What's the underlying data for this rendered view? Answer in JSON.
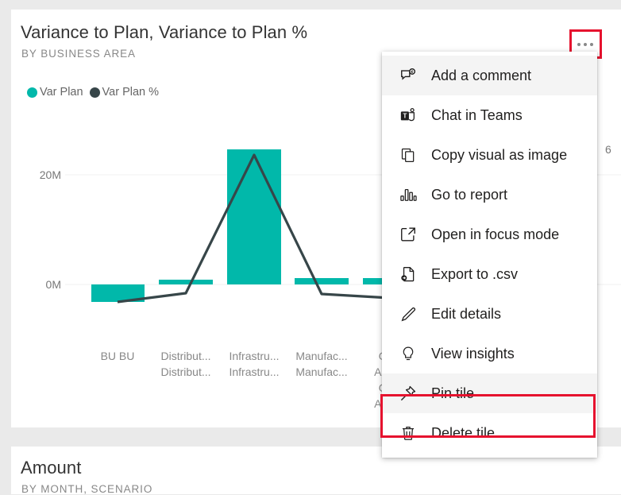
{
  "tiles": {
    "variance": {
      "title": "Variance to Plan, Variance to Plan %",
      "subtitle": "BY BUSINESS AREA"
    },
    "amount": {
      "title": "Amount",
      "subtitle": "BY MONTH, SCENARIO"
    }
  },
  "more_options": {
    "label": "...",
    "highlight_color": "#e6122e"
  },
  "context_menu": {
    "items": [
      {
        "label": "Add a comment",
        "icon": "comment-icon",
        "hovered": true,
        "highlighted": false
      },
      {
        "label": "Chat in Teams",
        "icon": "teams-icon",
        "hovered": false,
        "highlighted": false
      },
      {
        "label": "Copy visual as image",
        "icon": "copy-icon",
        "hovered": false,
        "highlighted": false
      },
      {
        "label": "Go to report",
        "icon": "bar-chart-icon",
        "hovered": false,
        "highlighted": false
      },
      {
        "label": "Open in focus mode",
        "icon": "focus-mode-icon",
        "hovered": false,
        "highlighted": false
      },
      {
        "label": "Export to .csv",
        "icon": "export-file-icon",
        "hovered": false,
        "highlighted": false
      },
      {
        "label": "Edit details",
        "icon": "pencil-icon",
        "hovered": false,
        "highlighted": false
      },
      {
        "label": "View insights",
        "icon": "lightbulb-icon",
        "hovered": false,
        "highlighted": false
      },
      {
        "label": "Pin tile",
        "icon": "pin-icon",
        "hovered": true,
        "highlighted": true
      },
      {
        "label": "Delete tile",
        "icon": "trash-icon",
        "hovered": false,
        "highlighted": false
      }
    ]
  },
  "chart_data": {
    "type": "bar",
    "title": "Variance to Plan, Variance to Plan %",
    "subtitle": "BY BUSINESS AREA",
    "xlabel": "",
    "ylabel": "",
    "grid": true,
    "legend_position": "top-left",
    "colors": {
      "bar": "#01b8aa",
      "line": "#374649"
    },
    "categories": [
      "BU BU",
      "Distribut... Distribut...",
      "Infrastru... Infrastru...",
      "Manufac... Manufac...",
      "Office Admin... Office Admin..."
    ],
    "axis": {
      "y_ticks": [
        "0M",
        "20M"
      ],
      "y_tick_values": [
        0,
        20000000
      ],
      "ylim": [
        -4000000,
        24000000
      ],
      "secondary_axis_cut_label": "6"
    },
    "series": [
      {
        "name": "Var Plan",
        "type": "bar",
        "color": "#01b8aa",
        "values": [
          -2600000,
          700000,
          21800000,
          1000000,
          900000
        ]
      },
      {
        "name": "Var Plan %",
        "type": "line",
        "color": "#374649",
        "values": [
          -3.0,
          -0.9,
          6.0,
          -0.9,
          -1.4
        ]
      }
    ]
  }
}
